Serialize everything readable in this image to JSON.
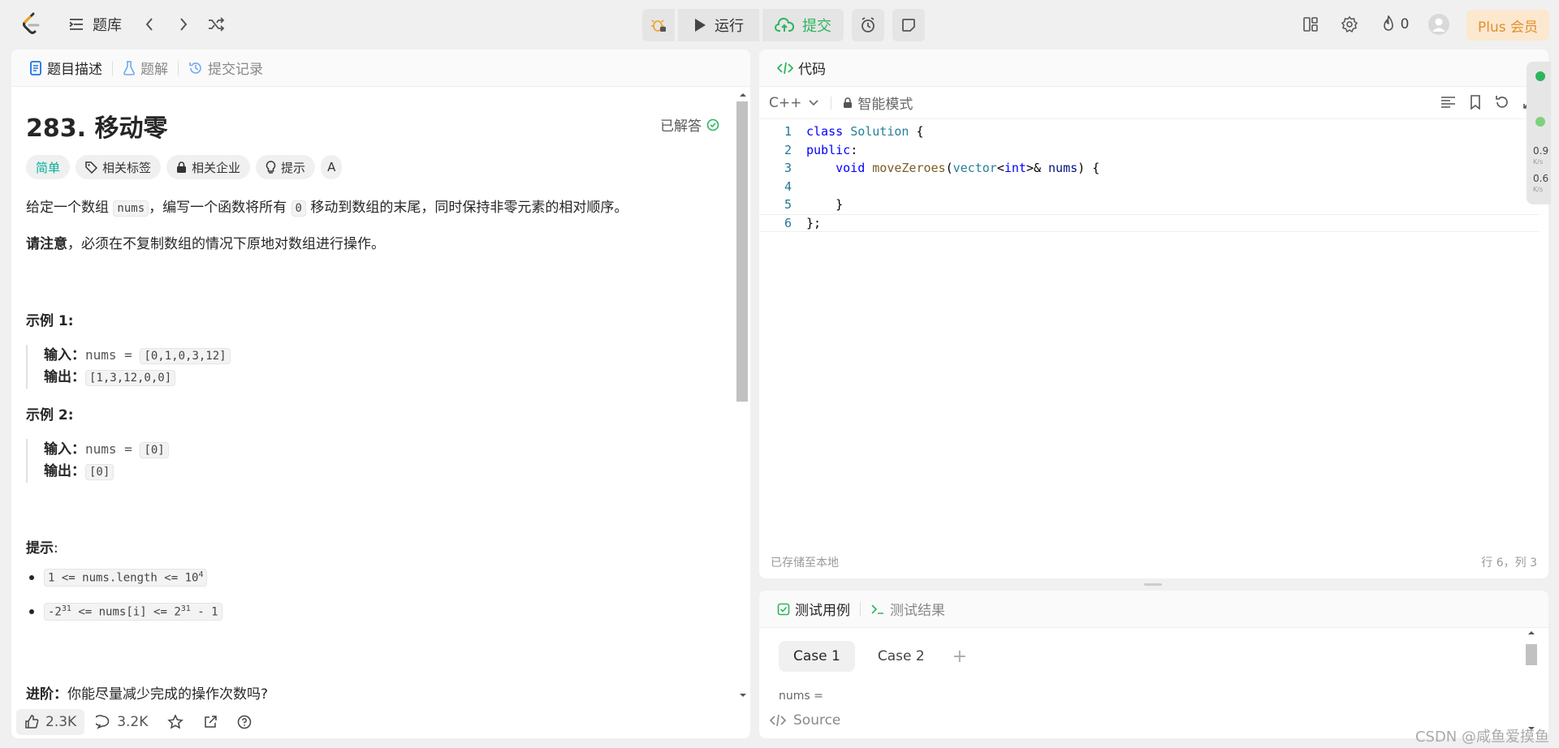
{
  "topbar": {
    "problem_list": "题库",
    "run": "运行",
    "submit": "提交",
    "points": "0",
    "plus": "Plus 会员"
  },
  "left": {
    "tabs": [
      "题目描述",
      "题解",
      "提交记录"
    ],
    "title": "283. 移动零",
    "solved": "已解答",
    "chips": [
      "简单",
      "相关标签",
      "相关企业",
      "提示",
      "A"
    ],
    "desc_prefix": "给定一个数组 ",
    "desc_code1": "nums",
    "desc_mid": "，编写一个函数将所有 ",
    "desc_code2": "0",
    "desc_suffix": " 移动到数组的末尾，同时保持非零元素的相对顺序。",
    "note_bold": "请注意",
    "note_rest": "，必须在不复制数组的情况下原地对数组进行操作。",
    "example1_title": "示例 1:",
    "example2_title": "示例 2:",
    "input_label": "输入：",
    "output_label": "输出：",
    "ex1_input_var": "nums = ",
    "ex1_input": "[0,1,0,3,12]",
    "ex1_output": "[1,3,12,0,0]",
    "ex2_input_var": "nums = ",
    "ex2_input": "[0]",
    "ex2_output": "[0]",
    "hints_title": "提示",
    "hint1_a": "1 <= nums.length <= 10",
    "hint1_sup": "4",
    "hint2_a": "-2",
    "hint2_sup1": "31",
    "hint2_b": " <= nums[i] <= 2",
    "hint2_sup2": "31",
    "hint2_c": " - 1",
    "advanced_bold": "进阶：",
    "advanced_rest": "你能尽量减少完成的操作次数吗?",
    "likes": "2.3K",
    "comments": "3.2K"
  },
  "code": {
    "tab": "代码",
    "lang": "C++",
    "mode": "智能模式",
    "saved": "已存储至本地",
    "cursor": "行 6，列 3",
    "speed_up": "0.9",
    "speed_down": "0.6",
    "speed_unit": "K/s",
    "lines": [
      "1",
      "2",
      "3",
      "4",
      "5",
      "6"
    ]
  },
  "test": {
    "tab_cases": "测试用例",
    "tab_result": "测试结果",
    "case1": "Case 1",
    "case2": "Case 2",
    "param": "nums =",
    "source": "Source"
  },
  "watermark": "CSDN @咸鱼爱摸鱼"
}
